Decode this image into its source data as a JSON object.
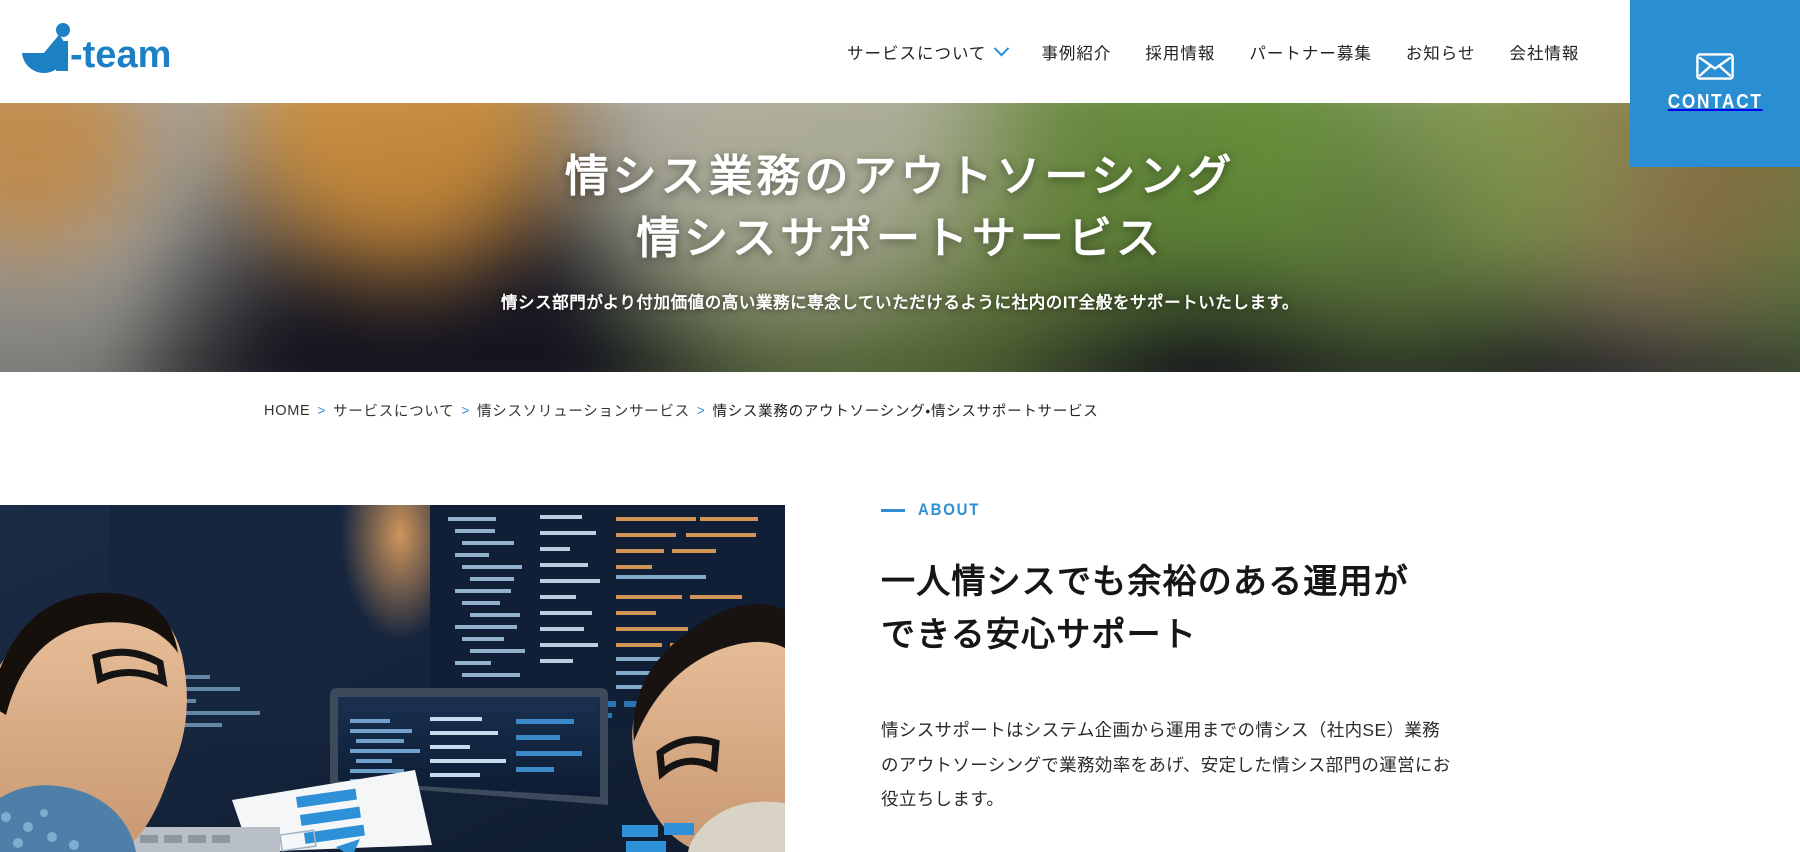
{
  "site": {
    "logo_text": "i-team",
    "accent_color": "#2a8ed2"
  },
  "header": {
    "nav_items": [
      {
        "label": "サービスについて",
        "has_dropdown": true
      },
      {
        "label": "事例紹介",
        "has_dropdown": false
      },
      {
        "label": "採用情報",
        "has_dropdown": false
      },
      {
        "label": "パートナー募集",
        "has_dropdown": false
      },
      {
        "label": "お知らせ",
        "has_dropdown": false
      },
      {
        "label": "会社情報",
        "has_dropdown": false
      }
    ],
    "contact": {
      "label": "CONTACT",
      "icon": "mail-icon",
      "background_color": "#2a8ed2"
    },
    "dropdown_icon": "chevron-down-icon"
  },
  "hero": {
    "title_line1": "情シス業務のアウトソーシング",
    "title_line2": "情シスサポートサービス",
    "subtitle": "情シス部門がより付加価値の高い業務に専念していただけるように社内のIT全般をサポートいたします。"
  },
  "breadcrumb": {
    "separator": ">",
    "items": [
      {
        "label": "HOME",
        "current": false
      },
      {
        "label": "サービスについて",
        "current": false
      },
      {
        "label": "情シスソリューションサービス",
        "current": false
      },
      {
        "label": "情シス業務のアウトソーシング・情シスサポートサービス",
        "current": true
      }
    ]
  },
  "about": {
    "eyebrow": "ABOUT",
    "heading_line1": "一人情シスでも余裕のある運用が",
    "heading_line2": "できる安心サポート",
    "body_line1": "情シスサポートはシステム企画から運用までの情シス（社内SE）業務",
    "body_line2": "のアウトソーシングで業務効率をあげ、安定した情シス部門の運営にお",
    "body_line3": "役立ちします。",
    "photo_alt": "二人のエンジニアがモニターでコードを見ている写真"
  }
}
